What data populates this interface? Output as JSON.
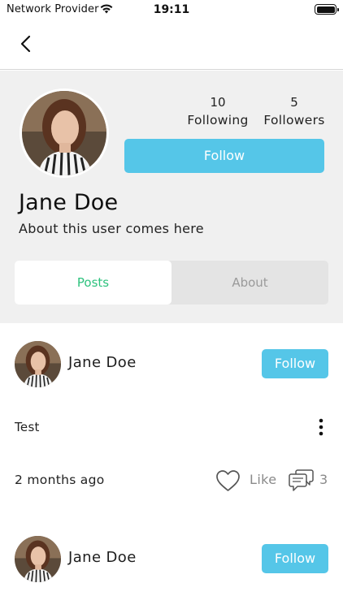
{
  "status_bar": {
    "carrier": "Network Provider",
    "time": "19:11",
    "icons": [
      "wifi-icon",
      "battery-icon"
    ]
  },
  "nav": {
    "back_icon": "chevron-left-icon"
  },
  "profile": {
    "name": "Jane Doe",
    "about": "About this user comes here",
    "following_count": "10",
    "following_label": "Following",
    "followers_count": "5",
    "followers_label": "Followers",
    "follow_label": "Follow"
  },
  "tabs": {
    "posts": "Posts",
    "about": "About",
    "active": "posts"
  },
  "posts": [
    {
      "author": "Jane Doe",
      "follow_label": "Follow",
      "text": "Test",
      "time": "2 months ago",
      "like_label": "Like",
      "comment_count": "3"
    },
    {
      "author": "Jane Doe",
      "follow_label": "Follow"
    }
  ],
  "colors": {
    "accent": "#55c6e8",
    "active_tab": "#2ec27e",
    "header_bg": "#f0f0f0",
    "muted": "#8a8a8a"
  }
}
